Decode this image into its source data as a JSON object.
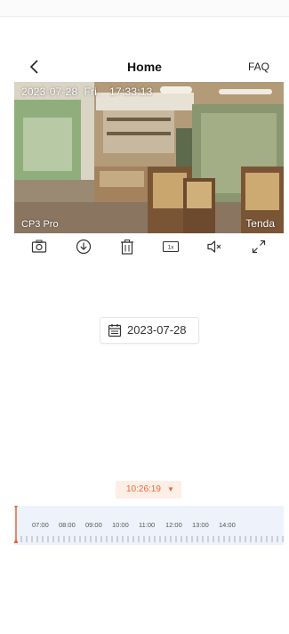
{
  "header": {
    "title": "Home",
    "faq_label": "FAQ"
  },
  "video": {
    "osd_time": "2023-07-28  Fri.   17:33:13",
    "model": "CP3 Pro",
    "brand": "Tenda"
  },
  "toolbar": {
    "snapshot_icon": "camera-icon",
    "download_icon": "download-icon",
    "delete_icon": "trash-icon",
    "speed_label": "1x",
    "mute_icon": "speaker-muted-icon",
    "fullscreen_icon": "expand-icon"
  },
  "date_picker": {
    "icon": "calendar-icon",
    "date": "2023-07-28"
  },
  "timeline": {
    "current_time": "10:26:19",
    "hours": [
      "07:00",
      "08:00",
      "09:00",
      "10:00",
      "11:00",
      "12:00",
      "13:00",
      "14:00"
    ],
    "accent": "#e46b3c"
  }
}
